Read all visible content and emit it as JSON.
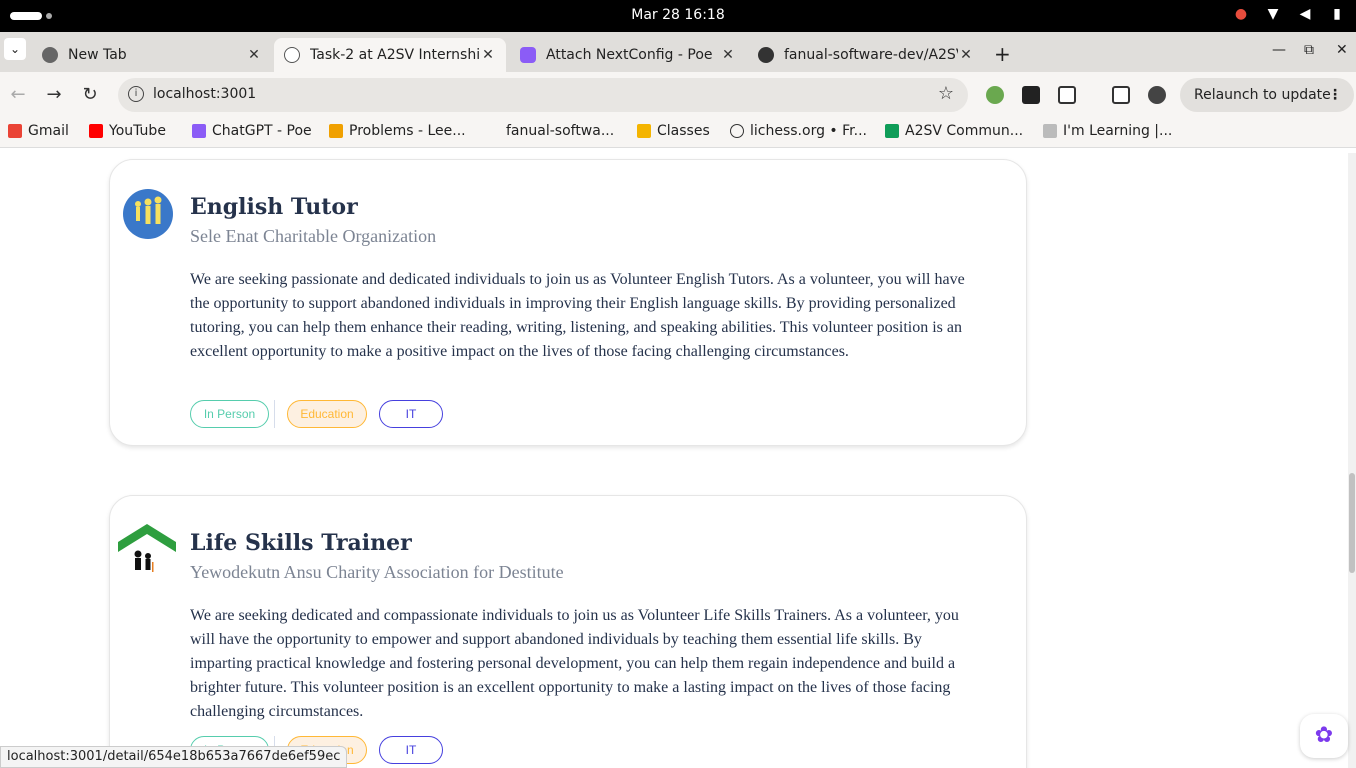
{
  "system": {
    "clock": "Mar 28  16:18"
  },
  "tabs": [
    {
      "title": "New Tab"
    },
    {
      "title": "Task-2 at A2SV Internship"
    },
    {
      "title": "Attach NextConfig - Poe"
    },
    {
      "title": "fanual-software-dev/A2SV"
    }
  ],
  "toolbar": {
    "url": "localhost:3001",
    "relaunch_label": "Relaunch to update"
  },
  "bookmarks": [
    {
      "label": "Gmail"
    },
    {
      "label": "YouTube"
    },
    {
      "label": "ChatGPT - Poe"
    },
    {
      "label": "Problems - Lee..."
    },
    {
      "label": "fanual-softwa..."
    },
    {
      "label": "Classes"
    },
    {
      "label": "lichess.org • Fr..."
    },
    {
      "label": "A2SV Commun..."
    },
    {
      "label": "I'm Learning |..."
    }
  ],
  "jobs": [
    {
      "title": "English Tutor",
      "organization": "Sele Enat Charitable Organization",
      "description": "We are seeking passionate and dedicated individuals to join us as Volunteer English Tutors. As a volunteer, you will have the opportunity to support abandoned individuals in improving their English language skills. By providing personalized tutoring, you can help them enhance their reading, writing, listening, and speaking abilities. This volunteer position is an excellent opportunity to make a positive impact on the lives of those facing challenging circumstances.",
      "tags": [
        "In Person",
        "Education",
        "IT"
      ]
    },
    {
      "title": "Life Skills Trainer",
      "organization": "Yewodekutn Ansu Charity Association for Destitute",
      "description": "We are seeking dedicated and compassionate individuals to join us as Volunteer Life Skills Trainers. As a volunteer, you will have the opportunity to empower and support abandoned individuals by teaching them essential life skills. By imparting practical knowledge and fostering personal development, you can help them regain independence and build a brighter future. This volunteer position is an excellent opportunity to make a lasting impact on the lives of those facing challenging circumstances.",
      "tags": [
        "In Person",
        "Education",
        "IT"
      ]
    }
  ],
  "status_url": "localhost:3001/detail/654e18b653a7667de6ef59ec",
  "colors": {
    "title": "#25324b",
    "org": "#7c8493",
    "tag_green": "#56cdad",
    "tag_orange": "#ffb836",
    "tag_purple": "#4640de"
  }
}
